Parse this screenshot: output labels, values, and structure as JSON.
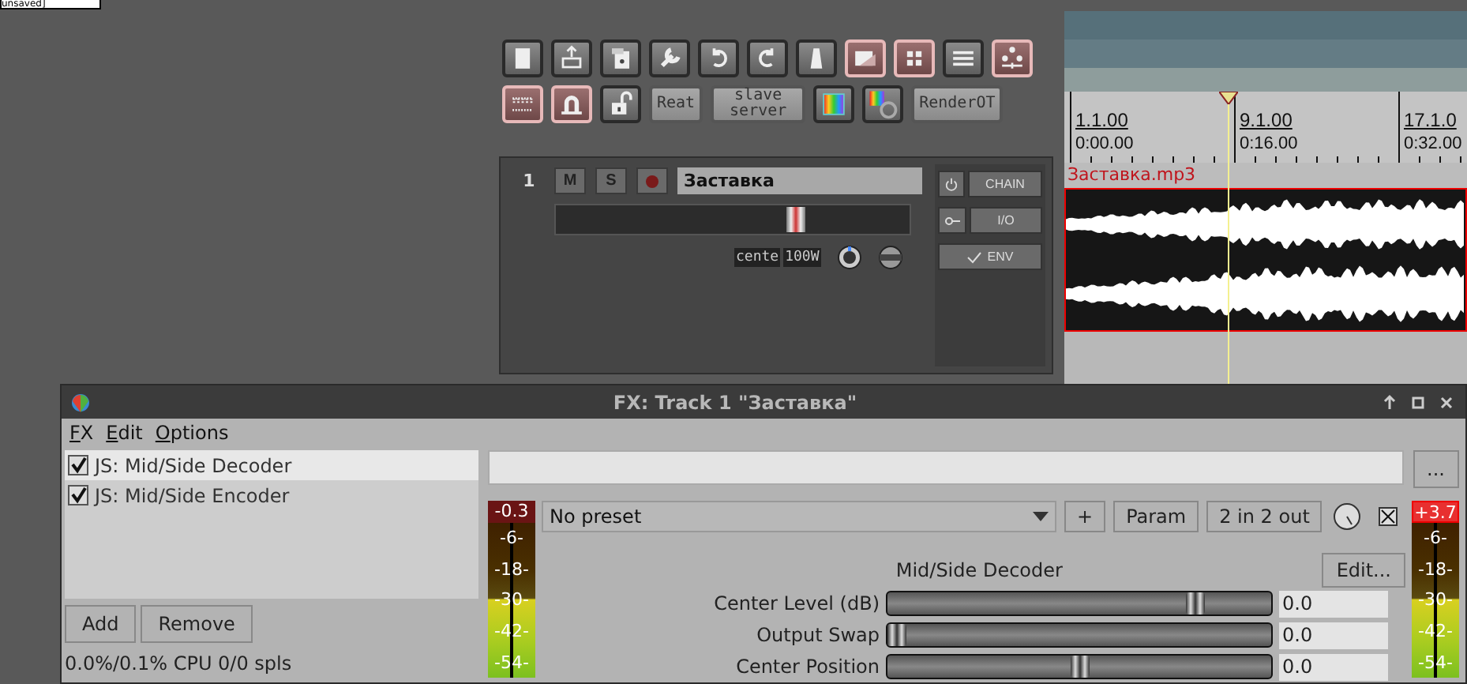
{
  "desktop_label": "unsaved]",
  "toolbar": {
    "rows": [
      [
        {
          "kind": "icon",
          "on": false
        },
        {
          "kind": "icon",
          "on": false
        },
        {
          "kind": "icon",
          "on": false
        },
        {
          "kind": "icon",
          "on": false
        },
        {
          "kind": "icon",
          "on": false
        },
        {
          "kind": "icon",
          "on": false
        },
        {
          "kind": "icon",
          "on": false
        },
        {
          "kind": "icon",
          "on": true
        },
        {
          "kind": "icon",
          "on": true
        },
        {
          "kind": "icon",
          "on": false
        },
        {
          "kind": "icon",
          "on": true
        }
      ],
      [
        {
          "kind": "icon",
          "on": true
        },
        {
          "kind": "icon",
          "on": true
        },
        {
          "kind": "icon",
          "on": false
        },
        {
          "kind": "text",
          "label": "Reat",
          "on": false
        },
        {
          "kind": "text",
          "label": "slave server",
          "on": false
        },
        {
          "kind": "icon",
          "on": false
        },
        {
          "kind": "icon",
          "on": false
        },
        {
          "kind": "text",
          "label": "RenderOT",
          "on": false
        }
      ]
    ]
  },
  "track": {
    "number": "1",
    "mute": "M",
    "solo": "S",
    "name": "Заставка",
    "volume": {
      "level": 0.68
    },
    "pan_label": "cente",
    "width_label": "100W",
    "fx_button": "CHAIN",
    "io_button": "I/O",
    "env_button": "ENV"
  },
  "arrange": {
    "ruler": [
      {
        "bar": "1.1.00",
        "time": "0:00.00"
      },
      {
        "bar": "9.1.00",
        "time": "0:16.00"
      },
      {
        "bar": "17.1.0",
        "time": "0:32.00"
      }
    ],
    "clip": {
      "name": "Заставка.mp3"
    }
  },
  "fx_window": {
    "title": "FX: Track 1 \"Заставка\"",
    "menu": [
      "FX",
      "Edit",
      "Options"
    ],
    "fx_list": [
      {
        "label": "JS: Mid/Side Decoder",
        "checked": true,
        "selected": true
      },
      {
        "label": "JS: Mid/Side Encoder",
        "checked": true,
        "selected": false
      }
    ],
    "buttons": [
      "Add",
      "Remove"
    ],
    "status": "0.0%/0.1% CPU 0/0 spls",
    "browse_button": "...",
    "preset": "No preset",
    "preset_buttons": [
      "+",
      "Param",
      "2 in 2 out"
    ],
    "bypass": {
      "checked": true
    },
    "meters": [
      {
        "peak": "-0.3",
        "clipped": false,
        "scale": [
          "-6-",
          "-18-",
          "-30-",
          "-42-",
          "-54-"
        ]
      },
      {
        "peak": "+3.7",
        "clipped": true,
        "scale": [
          "-6-",
          "-18-",
          "-30-",
          "-42-",
          "-54-"
        ]
      }
    ],
    "plugin_name": "Mid/Side Decoder",
    "edit_button": "Edit...",
    "params": [
      {
        "label": "Center Level (dB)",
        "level": 0.82,
        "value": "0.0"
      },
      {
        "label": "Output Swap",
        "level": 0.0,
        "value": "0.0"
      },
      {
        "label": "Center Position",
        "level": 0.5,
        "value": "0.0"
      }
    ]
  }
}
